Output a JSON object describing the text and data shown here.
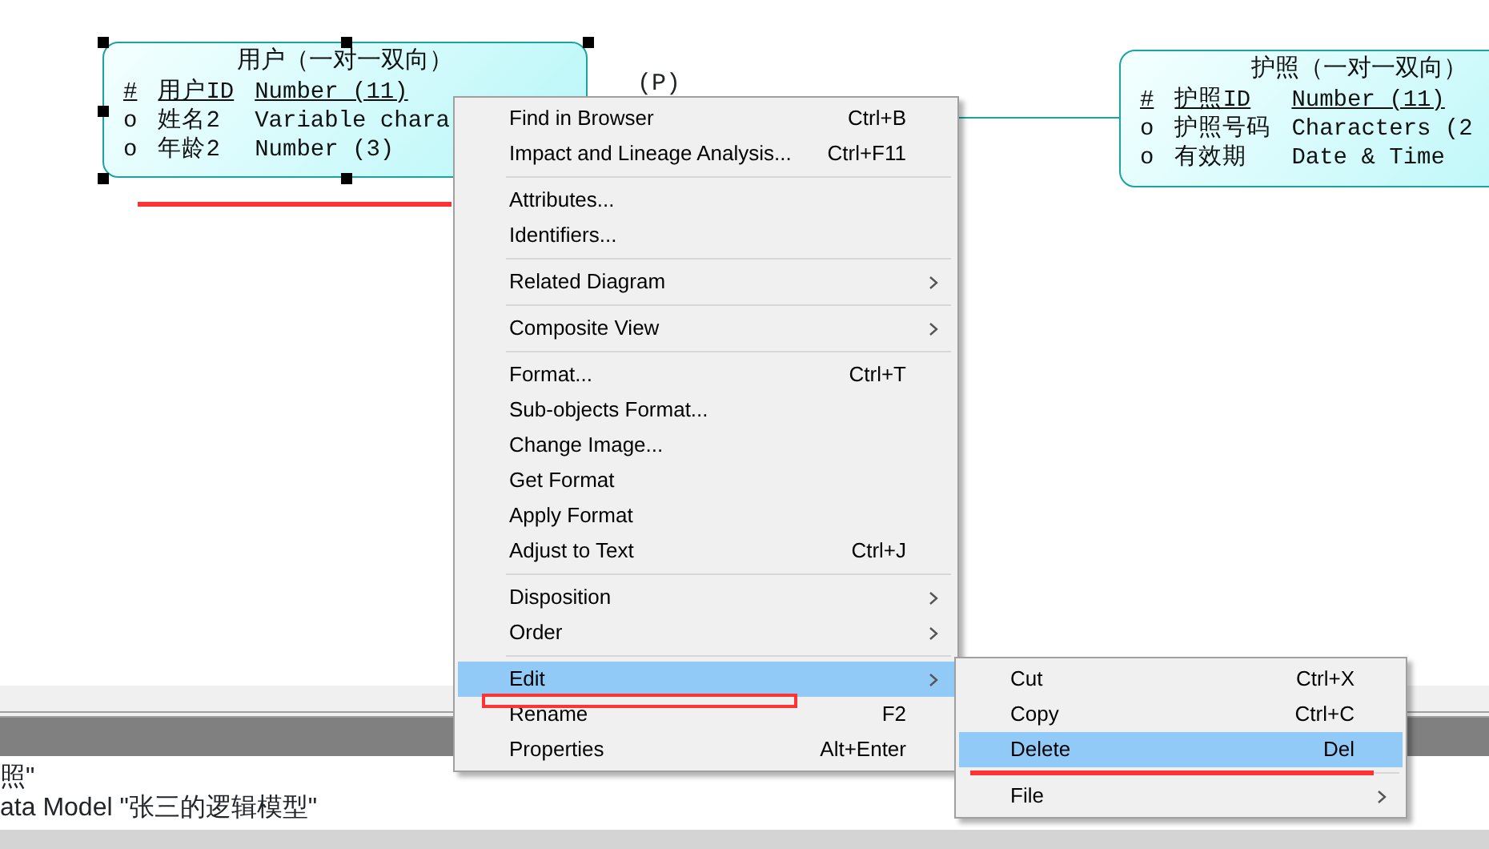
{
  "diagram": {
    "entities": [
      {
        "title": "用户（一对一双向）",
        "selected": true,
        "attributes": [
          {
            "marker": "#",
            "name": "用户ID",
            "type": "Number (11)",
            "identifier": true
          },
          {
            "marker": "o",
            "name": "姓名2",
            "type": "Variable chara",
            "identifier": false
          },
          {
            "marker": "o",
            "name": "年龄2",
            "type": "Number (3)",
            "identifier": false
          }
        ]
      },
      {
        "title": "护照（一对一双向）",
        "selected": false,
        "attributes": [
          {
            "marker": "#",
            "name": "护照ID",
            "type": "Number (11)",
            "identifier": true
          },
          {
            "marker": "o",
            "name": "护照号码",
            "type": "Characters (2",
            "identifier": false
          },
          {
            "marker": "o",
            "name": "有效期",
            "type": "Date & Time",
            "identifier": false
          }
        ]
      }
    ],
    "relationship_label": "(P)"
  },
  "context_menu": {
    "groups": [
      [
        {
          "label": "Find in Browser",
          "shortcut": "Ctrl+B",
          "submenu": false,
          "selected": false
        },
        {
          "label": "Impact and Lineage Analysis...",
          "shortcut": "Ctrl+F11",
          "submenu": false,
          "selected": false
        }
      ],
      [
        {
          "label": "Attributes...",
          "submenu": false,
          "selected": false
        },
        {
          "label": "Identifiers...",
          "submenu": false,
          "selected": false
        }
      ],
      [
        {
          "label": "Related Diagram",
          "submenu": true,
          "selected": false
        }
      ],
      [
        {
          "label": "Composite View",
          "submenu": true,
          "selected": false
        }
      ],
      [
        {
          "label": "Format...",
          "shortcut": "Ctrl+T",
          "submenu": false,
          "selected": false
        },
        {
          "label": "Sub-objects Format...",
          "submenu": false,
          "selected": false
        },
        {
          "label": "Change Image...",
          "submenu": false,
          "selected": false
        },
        {
          "label": "Get Format",
          "submenu": false,
          "selected": false
        },
        {
          "label": "Apply Format",
          "submenu": false,
          "selected": false
        },
        {
          "label": "Adjust to Text",
          "shortcut": "Ctrl+J",
          "submenu": false,
          "selected": false
        }
      ],
      [
        {
          "label": "Disposition",
          "submenu": true,
          "selected": false
        },
        {
          "label": "Order",
          "submenu": true,
          "selected": false
        }
      ],
      [
        {
          "label": "Edit",
          "submenu": true,
          "selected": true
        },
        {
          "label": "Rename",
          "shortcut": "F2",
          "submenu": false,
          "selected": false
        },
        {
          "label": "Properties",
          "shortcut": "Alt+Enter",
          "submenu": false,
          "selected": false
        }
      ]
    ]
  },
  "edit_submenu": {
    "groups": [
      [
        {
          "label": "Cut",
          "shortcut": "Ctrl+X",
          "submenu": false,
          "selected": false
        },
        {
          "label": "Copy",
          "shortcut": "Ctrl+C",
          "submenu": false,
          "selected": false
        },
        {
          "label": "Delete",
          "shortcut": "Del",
          "submenu": false,
          "selected": true
        }
      ],
      [
        {
          "label": "File",
          "submenu": true,
          "selected": false
        }
      ]
    ]
  },
  "output_lines": [
    "照\"",
    "ata Model \"张三的逻辑模型\""
  ]
}
